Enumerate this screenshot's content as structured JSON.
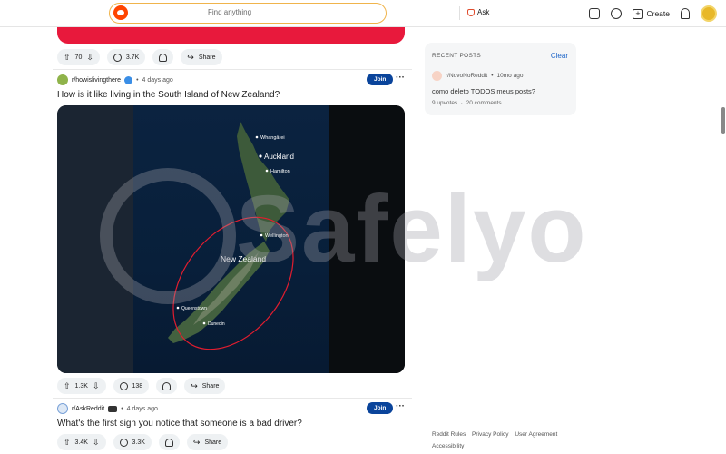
{
  "header": {
    "search_placeholder": "Find anything",
    "ask_label": "Ask",
    "create_label": "Create"
  },
  "feed": {
    "first_post_actions": {
      "votes": "70",
      "comments": "3.7K",
      "share": "Share"
    },
    "posts": [
      {
        "subreddit": "r/howislivingthere",
        "time": "4 days ago",
        "join": "Join",
        "title": "How is it like living in the South Island of New Zealand?",
        "image": {
          "labels": [
            "Whangārei",
            "Auckland",
            "Hamilton",
            "Wellington",
            "New Zealand",
            "Queenstown",
            "Dunedin"
          ]
        },
        "votes": "1.3K",
        "comments": "138",
        "share": "Share"
      },
      {
        "subreddit": "r/AskReddit",
        "time": "4 days ago",
        "join": "Join",
        "title": "What's the first sign you notice that someone is a bad driver?",
        "votes": "3.4K",
        "comments": "3.3K",
        "share": "Share"
      }
    ]
  },
  "watermark": "Safelyo",
  "recent_posts": {
    "heading": "RECENT POSTS",
    "clear": "Clear",
    "subreddit": "r/NovoNoReddit",
    "time": "10mo ago",
    "title": "como deleto TODOS meus posts?",
    "upvotes": "9 upvotes",
    "comments": "20 comments"
  },
  "footer": {
    "links": [
      "Reddit Rules",
      "Privacy Policy",
      "User Agreement",
      "Accessibility"
    ]
  },
  "colors": {
    "accent": "#ff4500",
    "join": "#0a449b",
    "banner": "#e8193c"
  }
}
